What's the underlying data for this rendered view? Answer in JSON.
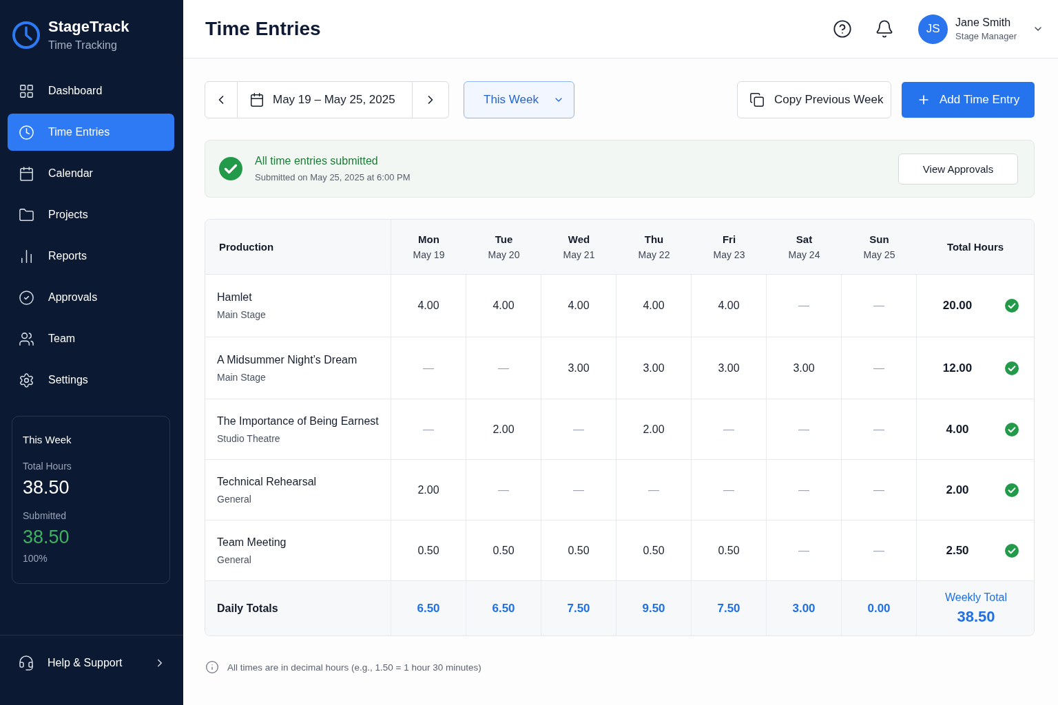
{
  "sidebar": {
    "brand": {
      "name": "StageTrack",
      "subtitle": "Time Tracking"
    },
    "nav": [
      {
        "label": "Dashboard",
        "selected": false
      },
      {
        "label": "Time Entries",
        "selected": true
      },
      {
        "label": "Calendar",
        "selected": false
      },
      {
        "label": "Projects",
        "selected": false
      },
      {
        "label": "Reports",
        "selected": false
      },
      {
        "label": "Approvals",
        "selected": false
      },
      {
        "label": "Team",
        "selected": false
      },
      {
        "label": "Settings",
        "selected": false
      }
    ],
    "summary": {
      "title": "This Week",
      "total_label": "Total Hours",
      "total_value": "38.50",
      "submitted_label": "Submitted",
      "submitted_value": "38.50",
      "percent": "100%"
    },
    "help": {
      "label": "Help & Support"
    }
  },
  "header": {
    "title": "Time Entries",
    "user": {
      "initials": "JS",
      "name": "Jane Smith",
      "role": "Stage Manager"
    }
  },
  "toolbar": {
    "date_range": "May 19 – May 25, 2025",
    "period": "This Week",
    "copy_button": "Copy Previous Week",
    "add_button": "Add Time Entry"
  },
  "banner": {
    "title": "All time entries submitted",
    "subtitle": "Submitted on May 25, 2025 at 6:00 PM",
    "button": "View Approvals"
  },
  "table": {
    "production_header": "Production",
    "days": [
      {
        "day": "Mon",
        "date": "May 19"
      },
      {
        "day": "Tue",
        "date": "May 20"
      },
      {
        "day": "Wed",
        "date": "May 21"
      },
      {
        "day": "Thu",
        "date": "May 22"
      },
      {
        "day": "Fri",
        "date": "May 23"
      },
      {
        "day": "Sat",
        "date": "May 24"
      },
      {
        "day": "Sun",
        "date": "May 25"
      }
    ],
    "total_header": "Total Hours",
    "rows": [
      {
        "production": "Hamlet",
        "venue": "Main Stage",
        "cells": [
          {
            "value": "4.00",
            "empty": false
          },
          {
            "value": "4.00",
            "empty": false
          },
          {
            "value": "4.00",
            "empty": false
          },
          {
            "value": "4.00",
            "empty": false
          },
          {
            "value": "4.00",
            "empty": false
          },
          {
            "value": "—",
            "empty": true
          },
          {
            "value": "—",
            "empty": true
          }
        ],
        "total": "20.00",
        "approved": true
      },
      {
        "production": "A Midsummer Night’s Dream",
        "venue": "Main Stage",
        "cells": [
          {
            "value": "—",
            "empty": true
          },
          {
            "value": "—",
            "empty": true
          },
          {
            "value": "3.00",
            "empty": false
          },
          {
            "value": "3.00",
            "empty": false
          },
          {
            "value": "3.00",
            "empty": false
          },
          {
            "value": "3.00",
            "empty": false
          },
          {
            "value": "—",
            "empty": true
          }
        ],
        "total": "12.00",
        "approved": true
      },
      {
        "production": "The Importance of Being Earnest",
        "venue": "Studio Theatre",
        "cells": [
          {
            "value": "—",
            "empty": true
          },
          {
            "value": "2.00",
            "empty": false
          },
          {
            "value": "—",
            "empty": true
          },
          {
            "value": "2.00",
            "empty": false
          },
          {
            "value": "—",
            "empty": true
          },
          {
            "value": "—",
            "empty": true
          },
          {
            "value": "—",
            "empty": true
          }
        ],
        "total": "4.00",
        "approved": true
      },
      {
        "production": "Technical Rehearsal",
        "venue": "General",
        "cells": [
          {
            "value": "2.00",
            "empty": false
          },
          {
            "value": "—",
            "empty": true
          },
          {
            "value": "—",
            "empty": true
          },
          {
            "value": "—",
            "empty": true
          },
          {
            "value": "—",
            "empty": true
          },
          {
            "value": "—",
            "empty": true
          },
          {
            "value": "—",
            "empty": true
          }
        ],
        "total": "2.00",
        "approved": true
      },
      {
        "production": "Team Meeting",
        "venue": "General",
        "cells": [
          {
            "value": "0.50",
            "empty": false
          },
          {
            "value": "0.50",
            "empty": false
          },
          {
            "value": "0.50",
            "empty": false
          },
          {
            "value": "0.50",
            "empty": false
          },
          {
            "value": "0.50",
            "empty": false
          },
          {
            "value": "—",
            "empty": true
          },
          {
            "value": "—",
            "empty": true
          }
        ],
        "total": "2.50",
        "approved": true
      }
    ],
    "totals": {
      "label": "Daily Totals",
      "values": [
        "6.50",
        "6.50",
        "7.50",
        "9.50",
        "7.50",
        "3.00",
        "0.00"
      ],
      "weekly_label": "Weekly Total",
      "weekly_value": "38.50"
    }
  },
  "footnote": "All times are in decimal hours (e.g., 1.50 = 1 hour 30 minutes)"
}
